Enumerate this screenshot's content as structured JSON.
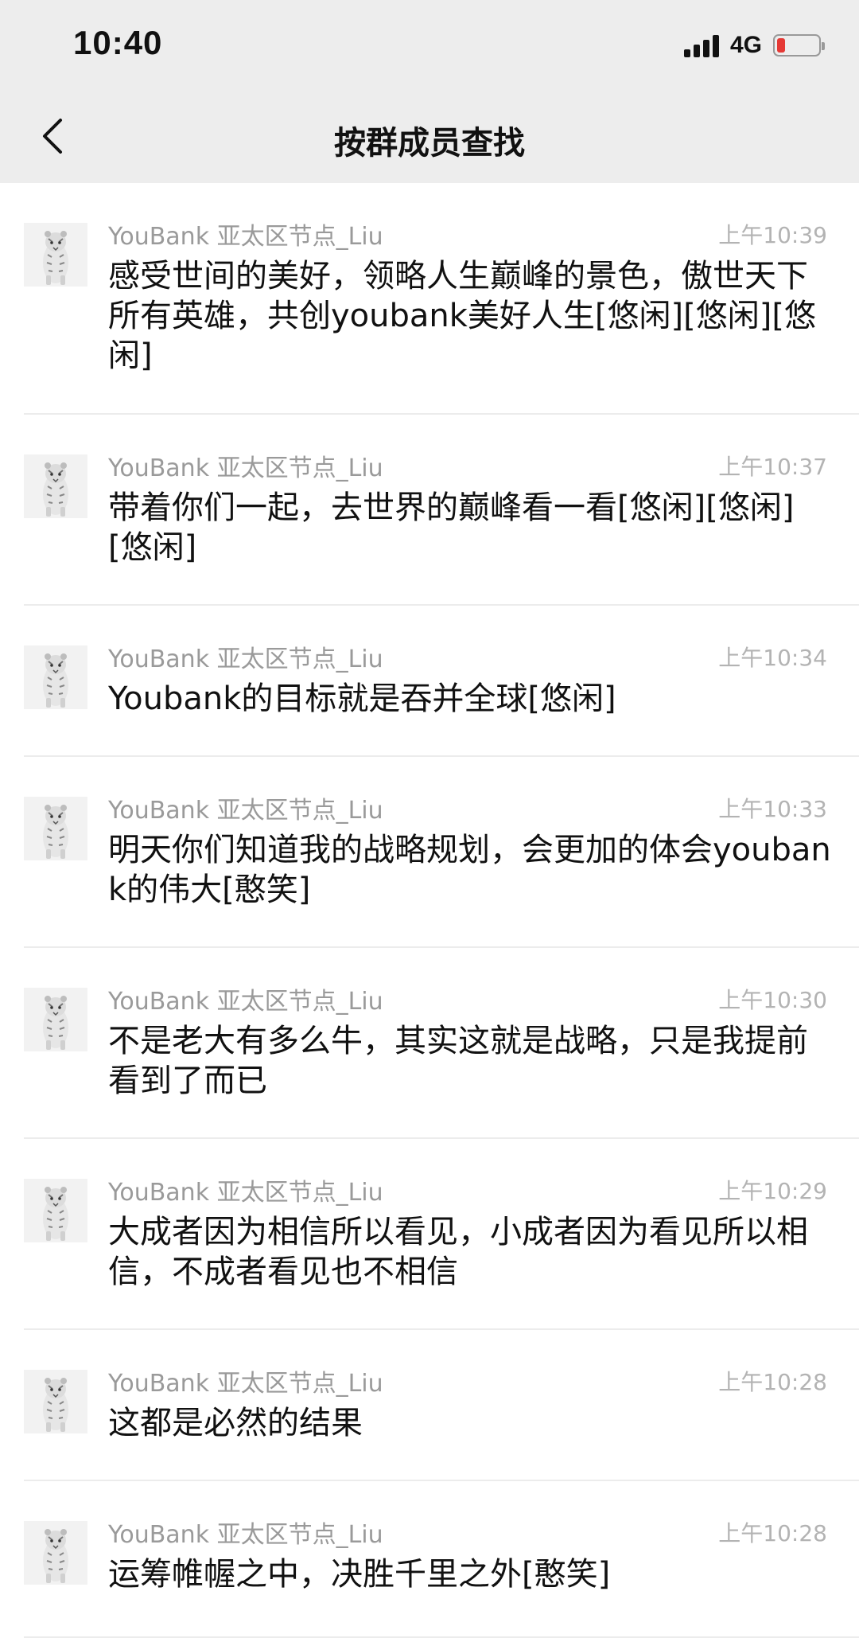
{
  "status_bar": {
    "time": "10:40",
    "network": "4G",
    "battery_level": 0.2,
    "battery_color": "#e53935"
  },
  "nav": {
    "back_icon": "chevron-left-icon",
    "title": "按群成员查找"
  },
  "messages": [
    {
      "sender": "YouBank 亚太区节点_Liu",
      "time": "上午10:39",
      "text": "感受世间的美好，领略人生巅峰的景色，傲世天下所有英雄，共创youbank美好人生[悠闲][悠闲][悠闲]"
    },
    {
      "sender": "YouBank 亚太区节点_Liu",
      "time": "上午10:37",
      "text": "带着你们一起，去世界的巅峰看一看[悠闲][悠闲][悠闲]"
    },
    {
      "sender": "YouBank 亚太区节点_Liu",
      "time": "上午10:34",
      "text": "Youbank的目标就是吞并全球[悠闲]"
    },
    {
      "sender": "YouBank 亚太区节点_Liu",
      "time": "上午10:33",
      "text": "明天你们知道我的战略规划，会更加的体会youbank的伟大[憨笑]"
    },
    {
      "sender": "YouBank 亚太区节点_Liu",
      "time": "上午10:30",
      "text": "不是老大有多么牛，其实这就是战略，只是我提前看到了而已"
    },
    {
      "sender": "YouBank 亚太区节点_Liu",
      "time": "上午10:29",
      "text": "大成者因为相信所以看见，小成者因为看见所以相信，不成者看见也不相信"
    },
    {
      "sender": "YouBank 亚太区节点_Liu",
      "time": "上午10:28",
      "text": "这都是必然的结果"
    },
    {
      "sender": "YouBank 亚太区节点_Liu",
      "time": "上午10:28",
      "text": "运筹帷幄之中，决胜千里之外[憨笑]"
    }
  ]
}
